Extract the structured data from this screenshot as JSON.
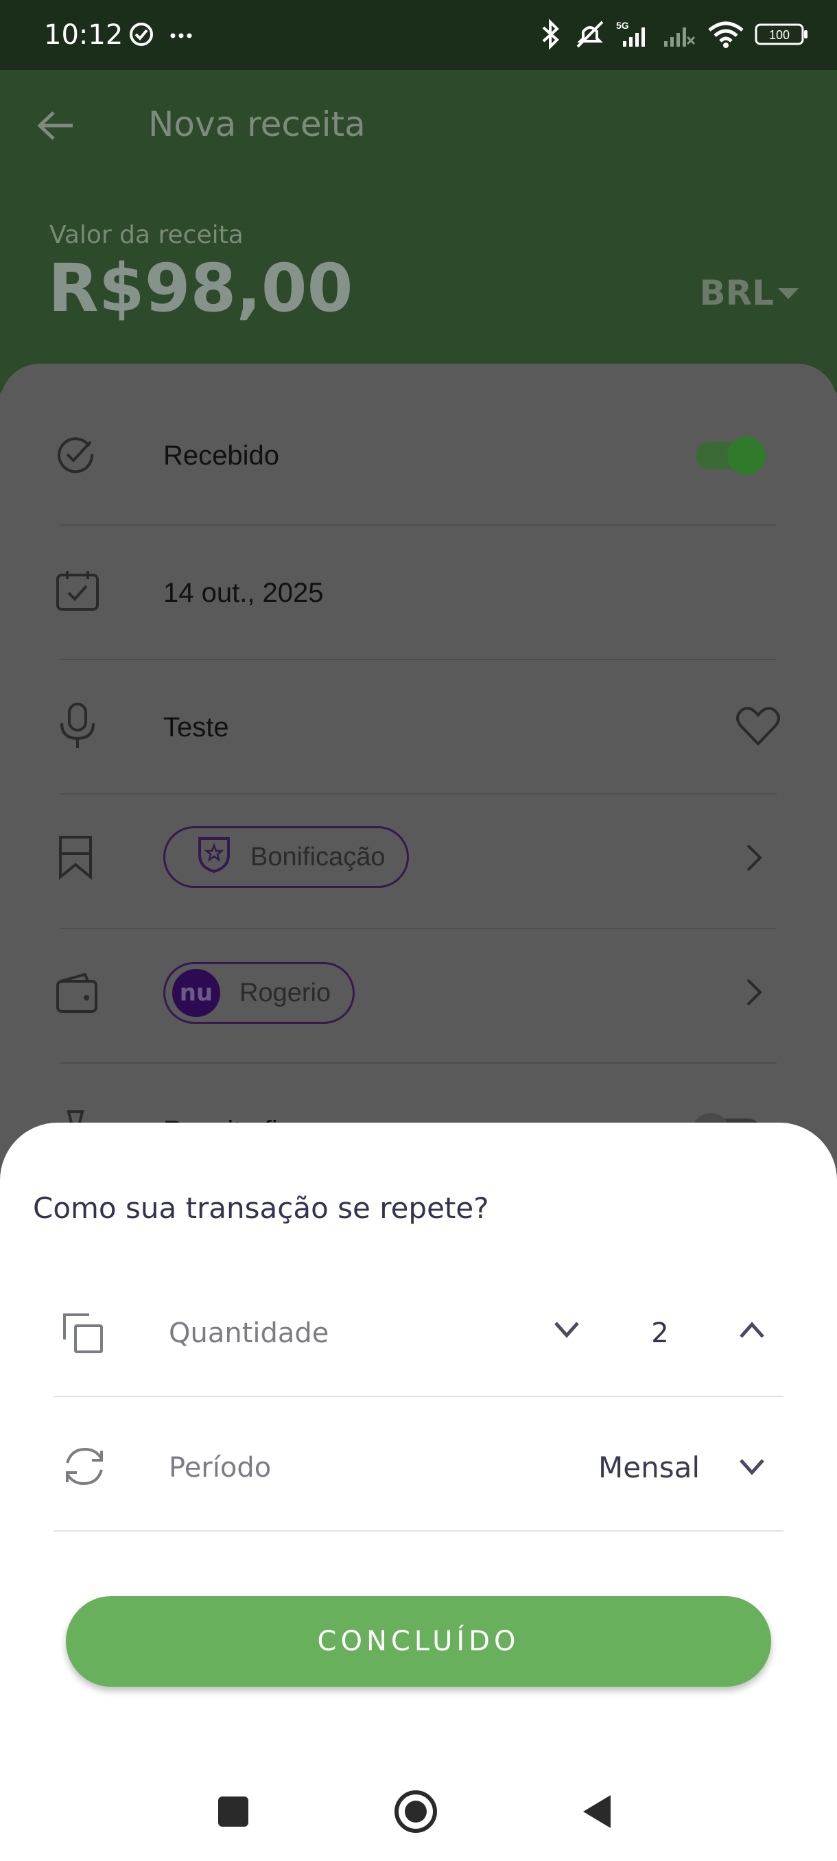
{
  "status_bar": {
    "time": "10:12",
    "left_icons": [
      "check-circle-icon",
      "more-dots-icon"
    ],
    "right_icons": [
      "bluetooth-icon",
      "mute-icon",
      "signal-5g-icon",
      "signal-icon",
      "wifi-icon",
      "battery-icon"
    ],
    "network_label": "5G",
    "battery": "100"
  },
  "header": {
    "title": "Nova receita",
    "amount_label": "Valor da receita",
    "amount": "R$98,00",
    "currency": "BRL",
    "bg_color": "#2d4a2b"
  },
  "form": {
    "received_label": "Recebido",
    "received_on": true,
    "date": "14 out., 2025",
    "description": "Teste",
    "category": "Bonificação",
    "account": "Rogerio",
    "account_logo": "nu",
    "fixed_label": "Receita fixa",
    "fixed_on": false
  },
  "modal": {
    "title": "Como sua transação se repete?",
    "quantity_label": "Quantidade",
    "quantity_value": "2",
    "period_label": "Período",
    "period_value": "Mensal",
    "done_label": "CONCLUÍDO",
    "accent_color": "#68b05b"
  },
  "nav": {
    "buttons": [
      "recent-apps",
      "home",
      "back"
    ]
  }
}
